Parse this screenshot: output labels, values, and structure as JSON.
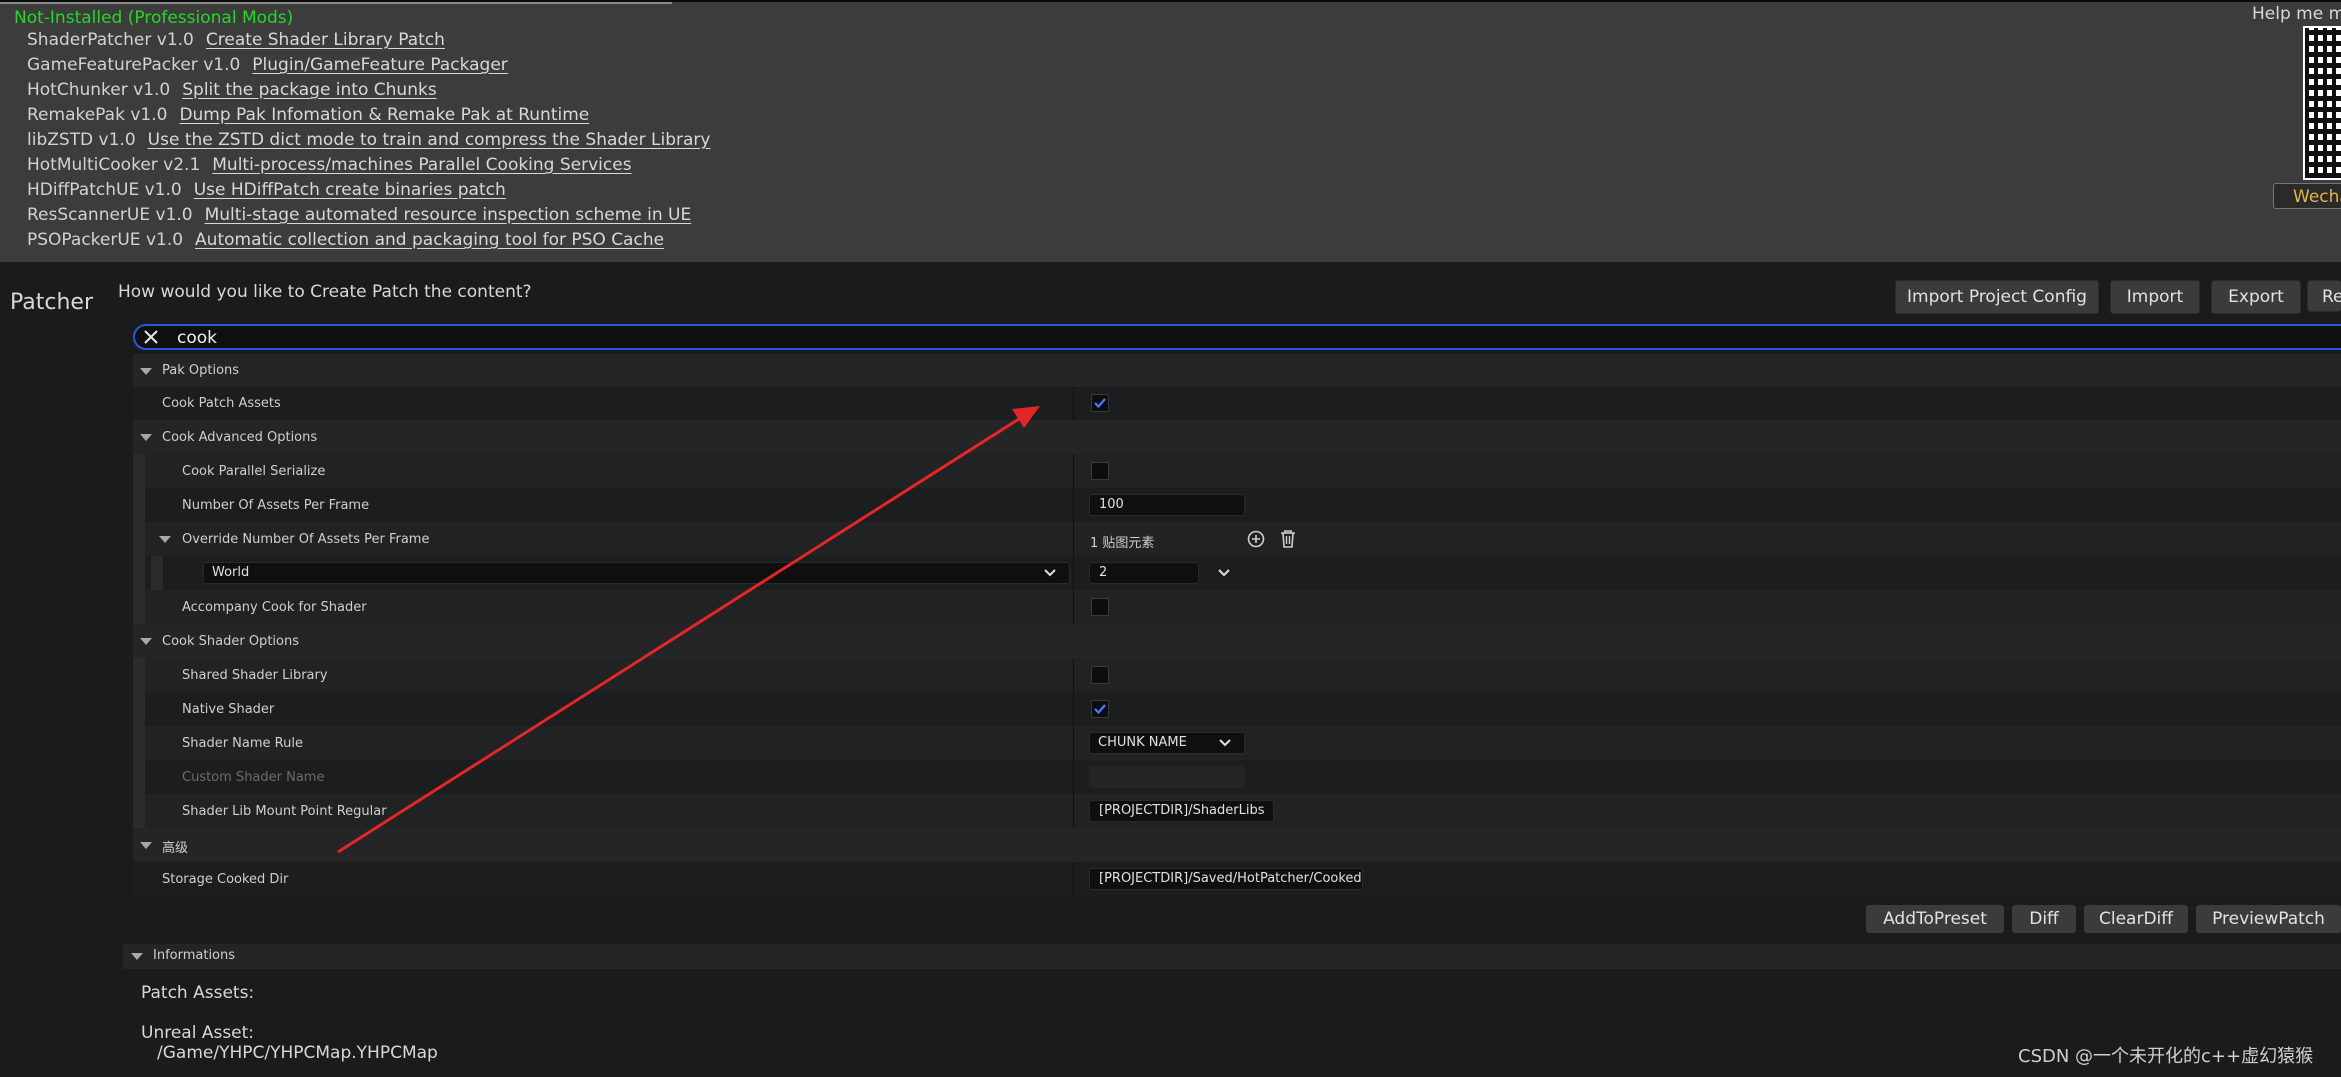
{
  "mods": {
    "header": "Not-Installed (Professional Mods)",
    "items": [
      {
        "name": "ShaderPatcher v1.0",
        "link": "Create Shader Library Patch"
      },
      {
        "name": "GameFeaturePacker v1.0",
        "link": "Plugin/GameFeature Packager"
      },
      {
        "name": "HotChunker v1.0",
        "link": "Split the package into Chunks"
      },
      {
        "name": "RemakePak v1.0",
        "link": "Dump Pak Infomation & Remake Pak at Runtime"
      },
      {
        "name": "libZSTD v1.0",
        "link": "Use the ZSTD dict mode to train and compress the Shader Library"
      },
      {
        "name": "HotMultiCooker v2.1",
        "link": "Multi-process/machines Parallel Cooking Services"
      },
      {
        "name": "HDiffPatchUE v1.0",
        "link": "Use HDiffPatch create binaries patch"
      },
      {
        "name": "ResScannerUE v1.0",
        "link": "Multi-stage automated resource inspection scheme in UE"
      },
      {
        "name": "PSOPackerUE v1.0",
        "link": "Automatic collection and packaging tool for PSO Cache"
      }
    ],
    "help_text": "Help me ma",
    "wechat_label": "Wecha"
  },
  "patcher": {
    "label": "Patcher",
    "question": "How would you like to Create Patch the content?",
    "buttons": {
      "import_project_config": "Import Project Config",
      "import": "Import",
      "export": "Export",
      "reset": "Re"
    }
  },
  "search": {
    "value": "cook"
  },
  "grid": {
    "pak_options": "Pak Options",
    "cook_patch_assets": "Cook Patch Assets",
    "cook_advanced_options": "Cook Advanced Options",
    "cook_parallel_serialize": "Cook Parallel Serialize",
    "number_of_assets_per_frame": "Number Of Assets Per Frame",
    "number_of_assets_value": "100",
    "override_number": "Override Number Of Assets Per Frame",
    "map_elements": "1 贴图元素",
    "world_select": "World",
    "world_value": "2",
    "accompany_cook": "Accompany Cook for Shader",
    "cook_shader_options": "Cook Shader Options",
    "shared_shader_library": "Shared Shader Library",
    "native_shader": "Native Shader",
    "shader_name_rule": "Shader Name Rule",
    "shader_name_rule_value": "CHUNK NAME",
    "custom_shader_name": "Custom Shader Name",
    "shader_lib_mount": "Shader Lib Mount Point Regular",
    "shader_lib_mount_value": "[PROJECTDIR]/ShaderLibs",
    "advanced": "高级",
    "storage_cooked_dir": "Storage Cooked Dir",
    "storage_cooked_dir_value": "[PROJECTDIR]/Saved/HotPatcher/Cooked"
  },
  "checks": {
    "cook_patch_assets": true,
    "cook_parallel_serialize": false,
    "accompany_cook": false,
    "shared_shader_library": false,
    "native_shader": true
  },
  "bottom": {
    "buttons": {
      "add_to_preset": "AddToPreset",
      "diff": "Diff",
      "clear_diff": "ClearDiff",
      "preview_patch": "PreviewPatch"
    },
    "informations": "Informations",
    "patch_assets": "Patch Assets:",
    "unreal_asset": "Unreal Asset:",
    "asset_path": "/Game/YHPC/YHPCMap.YHPCMap"
  },
  "watermark": "CSDN @一个未开化的c++虚幻猿猴",
  "colors": {
    "accent_blue": "#2f55e0",
    "mod_header_green": "#23d923",
    "wechat_gold": "#e7b44a",
    "arrow_red": "#e32626"
  }
}
